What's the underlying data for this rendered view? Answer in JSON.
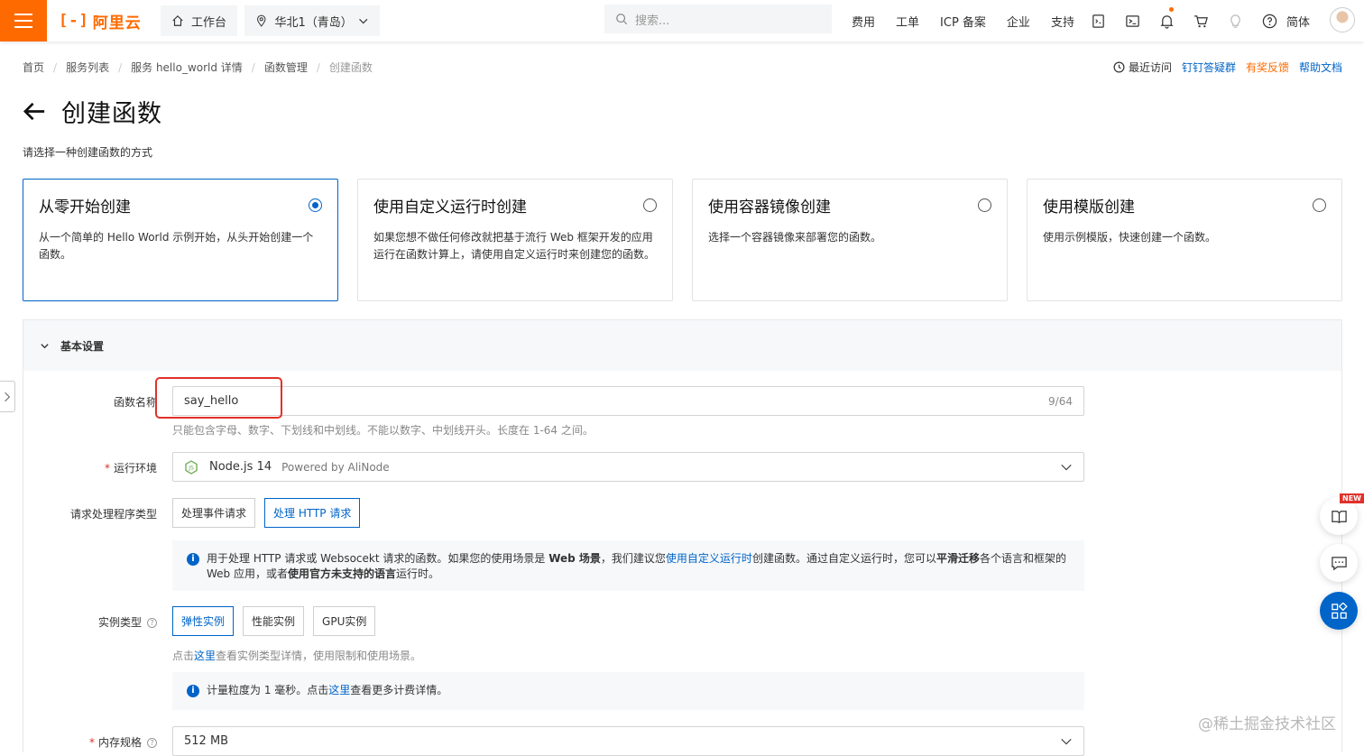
{
  "topbar": {
    "logo": "阿里云",
    "workbench": "工作台",
    "region": "华北1（青岛）",
    "search_placeholder": "搜索...",
    "links": [
      "费用",
      "工单",
      "ICP 备案",
      "企业",
      "支持"
    ],
    "lang": "简体"
  },
  "breadcrumb": {
    "items": [
      "首页",
      "服务列表",
      "服务 hello_world 详情",
      "函数管理"
    ],
    "current": "创建函数"
  },
  "rightlinks": {
    "recent": "最近访问",
    "dingtalk": "钉钉答疑群",
    "feedback": "有奖反馈",
    "help": "帮助文档"
  },
  "page": {
    "title": "创建函数",
    "subtitle": "请选择一种创建函数的方式"
  },
  "cards": [
    {
      "title": "从零开始创建",
      "desc": "从一个简单的 Hello World 示例开始，从头开始创建一个函数。",
      "selected": true
    },
    {
      "title": "使用自定义运行时创建",
      "desc": "如果您想不做任何修改就把基于流行 Web 框架开发的应用运行在函数计算上，请使用自定义运行时来创建您的函数。",
      "selected": false
    },
    {
      "title": "使用容器镜像创建",
      "desc": "选择一个容器镜像来部署您的函数。",
      "selected": false
    },
    {
      "title": "使用模版创建",
      "desc": "使用示例模版，快速创建一个函数。",
      "selected": false
    }
  ],
  "basic": {
    "section_title": "基本设置",
    "name_label": "函数名称",
    "name_value": "say_hello",
    "name_count": "9/64",
    "name_hint": "只能包含字母、数字、下划线和中划线。不能以数字、中划线开头。长度在 1-64 之间。",
    "runtime_label": "运行环境",
    "runtime_value": "Node.js 14",
    "runtime_powered": "Powered by AliNode",
    "handler_label": "请求处理程序类型",
    "handler_options": [
      "处理事件请求",
      "处理 HTTP 请求"
    ],
    "handler_info": {
      "p1": "用于处理 HTTP 请求或 Websocekt 请求的函数。如果您的使用场景是 ",
      "b1": "Web 场景",
      "p2": "，我们建议您",
      "link": "使用自定义运行时",
      "p3": "创建函数。通过自定义运行时，您可以",
      "b2": "平滑迁移",
      "p4": "各个语言和框架的 Web 应用，或者",
      "b3": "使用官方未支持的语言",
      "p5": "运行时。"
    },
    "instance_label": "实例类型",
    "instance_options": [
      "弹性实例",
      "性能实例",
      "GPU实例"
    ],
    "instance_hint_pre": "点击",
    "instance_hint_link": "这里",
    "instance_hint_post": "查看实例类型详情，使用限制和使用场景。",
    "billing_pre": "计量粒度为 1 毫秒。点击",
    "billing_link": "这里",
    "billing_post": "查看更多计费详情。",
    "memory_label": "内存规格",
    "memory_value": "512 MB"
  },
  "float": {
    "new": "NEW"
  },
  "watermark": "@稀土掘金技术社区",
  "colors": {
    "accent": "#ff6a00",
    "primary": "#0064c8",
    "highlight": "#e0322a"
  }
}
